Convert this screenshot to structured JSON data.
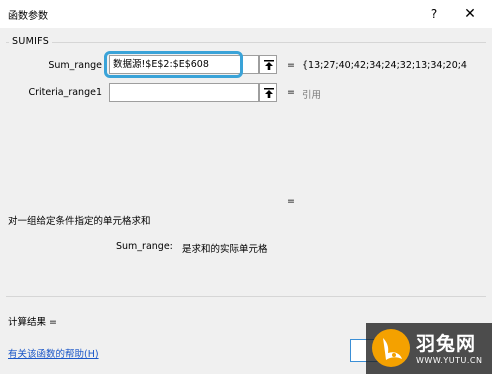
{
  "window": {
    "title": "函数参数",
    "help_glyph": "?",
    "close_glyph": "✕"
  },
  "function_name": "SUMIFS",
  "arguments": [
    {
      "label": "Sum_range",
      "value": "数据源!$E$2:$E$608",
      "preview": "{13;27;40;42;34;24;32;13;34;20;4"
    },
    {
      "label": "Criteria_range1",
      "value": "",
      "preview": "引用"
    }
  ],
  "equals_sign": "=",
  "result_equals": "=",
  "description": "对一组给定条件指定的单元格求和",
  "arg_description": {
    "name": "Sum_range:",
    "text": "是求和的实际单元格"
  },
  "calc_result_label": "计算结果 =",
  "help_link": "有关该函数的帮助(H)",
  "ok_button": {
    "label": ""
  },
  "watermark": {
    "text": "羽兔网",
    "sub": "WWW.YUTU.CN",
    "logo_color": "#f4a100"
  },
  "colors": {
    "highlight": "#3aa3d8",
    "link": "#1a56c8",
    "dialog_bg": "#f0f0f0"
  }
}
